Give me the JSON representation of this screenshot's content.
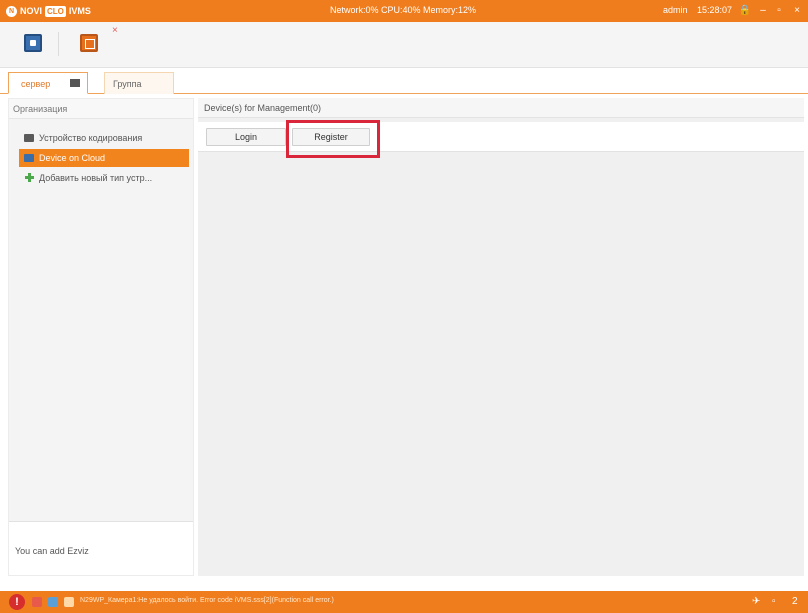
{
  "titlebar": {
    "brand": "NOVI",
    "brand_badge": "CLO",
    "app": "IVMS",
    "status": "Network:0% CPU:40% Memory:12%",
    "user": "admin",
    "time": "15:28:07",
    "lock_icon": "lock-icon",
    "minimize": "‒",
    "maximize": "▫",
    "close": "×"
  },
  "toolbar": {
    "items": [
      {
        "name": "main-view",
        "icon": "monitor-icon"
      },
      {
        "name": "control-panel",
        "icon": "window-icon"
      }
    ],
    "close_symbol": "×"
  },
  "tabs": {
    "server": "сервер",
    "group": "Группа"
  },
  "left_panel": {
    "header": "Организация",
    "items": [
      {
        "label": "Устройство кодирования",
        "icon": "encoder-device-icon"
      },
      {
        "label": "Device on Cloud",
        "icon": "cloud-device-icon",
        "selected": true
      },
      {
        "label": "Добавить новый тип устр...",
        "icon": "add-icon"
      }
    ],
    "footer": "You can add Ezviz"
  },
  "main": {
    "header": "Device(s) for Management(0)",
    "login": "Login",
    "register": "Register"
  },
  "statusbar": {
    "alarm": "!",
    "message": "N29WP_Камера1:Не удалось войти. Error code iVMS.sss[2](Function call error.)",
    "pin": "✈",
    "right_box": "▫",
    "right_num": "2"
  },
  "colors": {
    "accent": "#f07d1d",
    "selected": "#f2841e",
    "highlight": "#d9263a"
  }
}
